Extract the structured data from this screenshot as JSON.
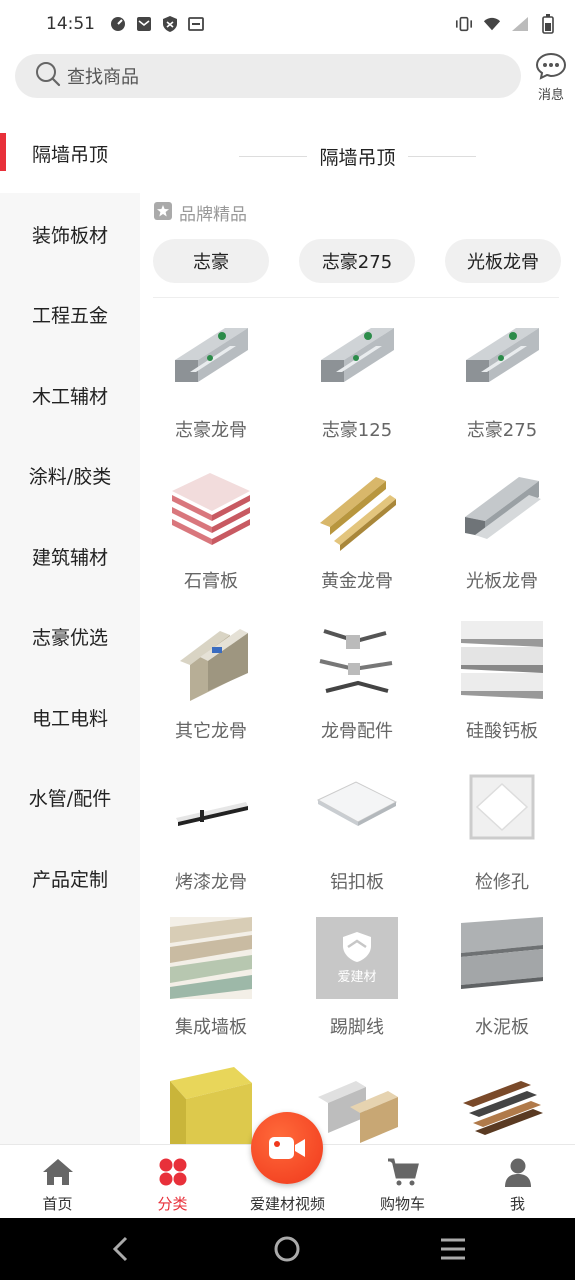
{
  "status_bar": {
    "time": "14:51"
  },
  "search": {
    "placeholder": "查找商品"
  },
  "message": {
    "label": "消息"
  },
  "sidebar": {
    "items": [
      {
        "label": "隔墙吊顶",
        "active": true
      },
      {
        "label": "装饰板材"
      },
      {
        "label": "工程五金"
      },
      {
        "label": "木工辅材"
      },
      {
        "label": "涂料/胶类"
      },
      {
        "label": "建筑辅材"
      },
      {
        "label": "志豪优选"
      },
      {
        "label": "电工电料"
      },
      {
        "label": "水管/配件"
      },
      {
        "label": "产品定制"
      }
    ]
  },
  "content": {
    "category_title": "隔墙吊顶",
    "brand_section_label": "品牌精品",
    "brand_chips": [
      "志豪",
      "志豪275",
      "光板龙骨"
    ],
    "products": [
      {
        "name": "志豪龙骨",
        "icon": "steel-keel-image"
      },
      {
        "name": "志豪125",
        "icon": "steel-keel-image"
      },
      {
        "name": "志豪275",
        "icon": "steel-keel-image"
      },
      {
        "name": "石膏板",
        "icon": "gypsum-board-image"
      },
      {
        "name": "黄金龙骨",
        "icon": "gold-keel-image"
      },
      {
        "name": "光板龙骨",
        "icon": "plain-keel-image"
      },
      {
        "name": "其它龙骨",
        "icon": "other-keel-image"
      },
      {
        "name": "龙骨配件",
        "icon": "keel-accessory-image"
      },
      {
        "name": "硅酸钙板",
        "icon": "calcium-silicate-board-image"
      },
      {
        "name": "烤漆龙骨",
        "icon": "painted-keel-image"
      },
      {
        "name": "铝扣板",
        "icon": "aluminum-panel-image"
      },
      {
        "name": "检修孔",
        "icon": "access-hatch-image"
      },
      {
        "name": "集成墙板",
        "icon": "wall-panel-image"
      },
      {
        "name": "踢脚线",
        "icon": "placeholder-logo-image",
        "logo_text": "爱建材"
      },
      {
        "name": "水泥板",
        "icon": "cement-board-image"
      },
      {
        "name": "",
        "icon": "insulation-wool-image"
      },
      {
        "name": "",
        "icon": "aluminum-square-tube-image"
      },
      {
        "name": "",
        "icon": "wood-grain-tube-image"
      }
    ]
  },
  "bottom_nav": {
    "items": [
      {
        "label": "首页",
        "icon": "home-icon"
      },
      {
        "label": "分类",
        "icon": "category-icon",
        "active": true
      },
      {
        "label": "爱建材视频",
        "icon": "video-camera-icon"
      },
      {
        "label": "购物车",
        "icon": "cart-icon"
      },
      {
        "label": "我",
        "icon": "profile-icon"
      }
    ]
  },
  "colors": {
    "accent": "#e8303a",
    "fab": "#f0381c"
  }
}
